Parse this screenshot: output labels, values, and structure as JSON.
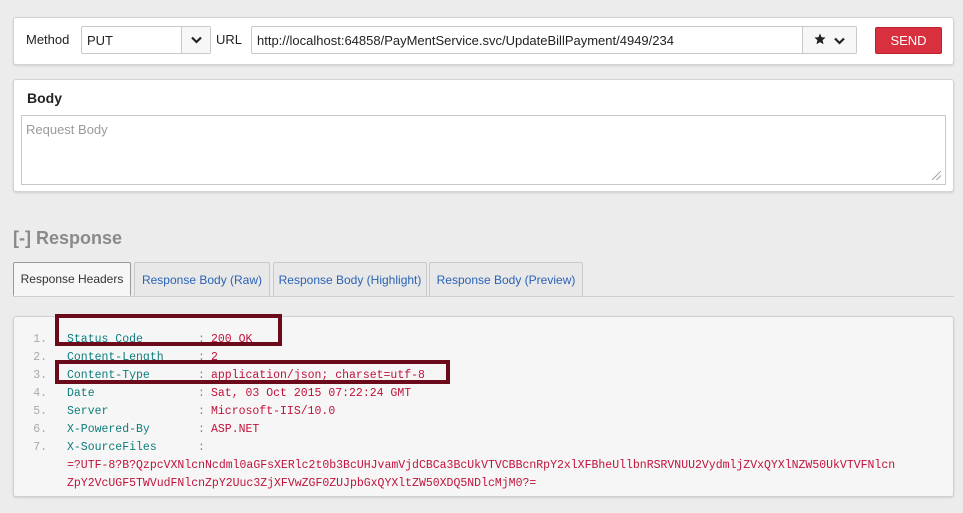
{
  "request": {
    "method_label": "Method",
    "method_value": "PUT",
    "url_label": "URL",
    "url_value": "http://localhost:64858/PayMentService.svc/UpdateBillPayment/4949/234",
    "send_label": "SEND",
    "chevron_glyph": "⌄",
    "star_glyph": "★"
  },
  "body": {
    "title": "Body",
    "placeholder": "Request Body"
  },
  "response": {
    "toggle": "[-]",
    "title": "Response",
    "tabs": [
      {
        "label": "Response Headers",
        "active": true
      },
      {
        "label": "Response Body (Raw)",
        "active": false
      },
      {
        "label": "Response Body (Highlight)",
        "active": false
      },
      {
        "label": "Response Body (Preview)",
        "active": false
      }
    ],
    "headers": [
      {
        "num": "1.",
        "name": "Status Code",
        "colon": ":",
        "value": "200 OK"
      },
      {
        "num": "2.",
        "name": "Content-Length",
        "colon": ":",
        "value": "2"
      },
      {
        "num": "3.",
        "name": "Content-Type",
        "colon": ":",
        "value": "application/json; charset=utf-8"
      },
      {
        "num": "4.",
        "name": "Date",
        "colon": ":",
        "value": "Sat, 03 Oct 2015 07:22:24 GMT"
      },
      {
        "num": "5.",
        "name": "Server",
        "colon": ":",
        "value": "Microsoft-IIS/10.0"
      },
      {
        "num": "6.",
        "name": "X-Powered-By",
        "colon": ":",
        "value": "ASP.NET"
      },
      {
        "num": "7.",
        "name": "X-SourceFiles",
        "colon": ":",
        "value": ""
      }
    ],
    "sourcefiles_line1": "=?UTF-8?B?QzpcVXNlcnNcdml0aGFsXERlc2t0b3BcUHJvamVjdCBCa3BcUkVTVCBBcnRpY2xlXFBheUllbnRSRVNUU2VydmljZVxQYXlNZW50UkVTVFNlcn",
    "sourcefiles_line2": "ZpY2VcUGF5TWVudFNlcnZpY2Uuc3ZjXFVwZGF0ZUJpbGxQYXltZW50XDQ5NDlcMjM0?="
  },
  "colors": {
    "send": "#d9303f",
    "header_name": "#0f7d7d",
    "header_value": "#c0133b",
    "highlight_box": "#6b0a1b",
    "link_tab": "#2a63b6"
  }
}
